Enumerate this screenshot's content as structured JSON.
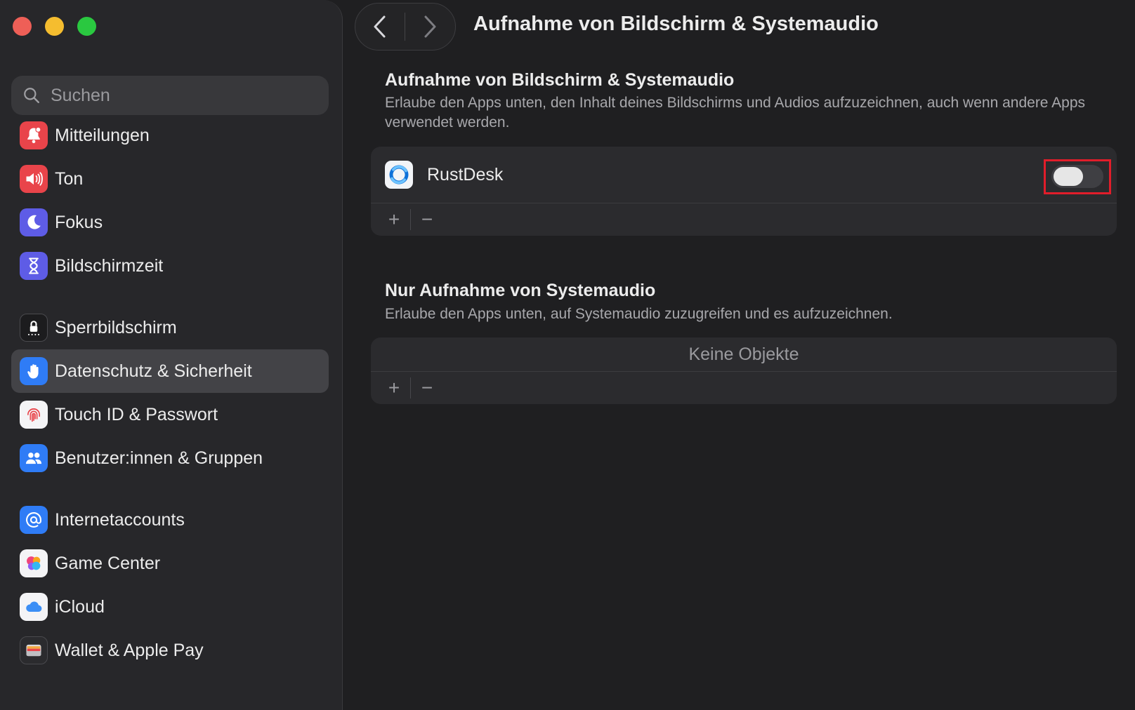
{
  "window": {
    "title": "Aufnahme von Bildschirm & Systemaudio"
  },
  "search": {
    "placeholder": "Suchen"
  },
  "sidebar": {
    "items": [
      {
        "label": "Mitteilungen",
        "icon": "bell-icon",
        "color": "#e9444a"
      },
      {
        "label": "Ton",
        "icon": "speaker-icon",
        "color": "#e9444a"
      },
      {
        "label": "Fokus",
        "icon": "moon-icon",
        "color": "#5e5ce6"
      },
      {
        "label": "Bildschirmzeit",
        "icon": "hourglass-icon",
        "color": "#5e5ce6"
      },
      {
        "label": "Sperrbildschirm",
        "icon": "lock-icon",
        "color": "#1c1c1e"
      },
      {
        "label": "Datenschutz & Sicherheit",
        "icon": "hand-icon",
        "color": "#2f7cf6",
        "active": true
      },
      {
        "label": "Touch ID & Passwort",
        "icon": "fingerprint-icon",
        "color": "#f4f4f6"
      },
      {
        "label": "Benutzer:innen & Gruppen",
        "icon": "users-icon",
        "color": "#2f7cf6"
      },
      {
        "label": "Internetaccounts",
        "icon": "at-icon",
        "color": "#2f7cf6"
      },
      {
        "label": "Game Center",
        "icon": "game-center-icon",
        "color": "#f4f4f6"
      },
      {
        "label": "iCloud",
        "icon": "cloud-icon",
        "color": "#f4f4f6"
      },
      {
        "label": "Wallet & Apple Pay",
        "icon": "wallet-icon",
        "color": "#2b2b2e"
      }
    ]
  },
  "section1": {
    "title": "Aufnahme von Bildschirm & Systemaudio",
    "description": "Erlaube den Apps unten, den Inhalt deines Bildschirms und Audios aufzuzeichnen, auch wenn andere Apps verwendet werden.",
    "apps": [
      {
        "name": "RustDesk",
        "enabled": false
      }
    ]
  },
  "section2": {
    "title": "Nur Aufnahme von Systemaudio",
    "description": "Erlaube den Apps unten, auf Systemaudio zuzugreifen und es aufzuzeichnen.",
    "empty_text": "Keine Objekte"
  },
  "footer": {
    "add": "+",
    "remove": "−"
  }
}
